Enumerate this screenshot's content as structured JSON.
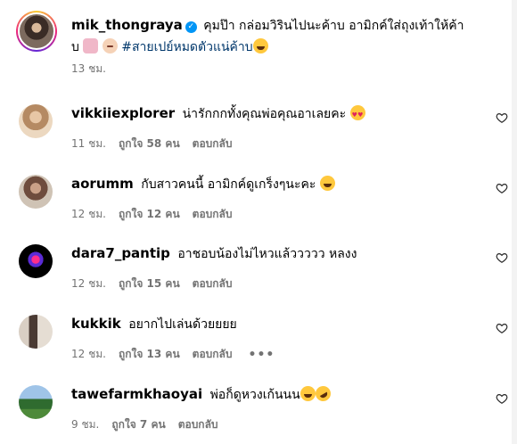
{
  "caption": {
    "username": "mik_thongraya",
    "text_line1": "คุมป๊า กล่อมวิรินไปนะค้าบ อามิกค์ใส่ถุงเท้าให้ค้า",
    "text_line2_prefix": "บ",
    "hashtag": "#สายเปย์หมดตัวแน่ค้าบ",
    "time": "13 ชม.",
    "emojis": [
      "ballet-shoes-emoji",
      "baby-emoji",
      "laughing-emoji"
    ]
  },
  "labels": {
    "reply": "ตอบกลับ",
    "more": "•••"
  },
  "comments": [
    {
      "username": "vikkiiexplorer",
      "text": "น่ารักกกทั้งคุณพ่อคุณอาเลยคะ",
      "emoji": "heart-eyes-emoji",
      "time": "11 ชม.",
      "likes": "ถูกใจ 58 คน"
    },
    {
      "username": "aorumm",
      "text": "กับสาวคนนี้ อามิกค์ดูเกร็งๆนะคะ",
      "emoji": "laughing-emoji",
      "time": "12 ชม.",
      "likes": "ถูกใจ 12 คน"
    },
    {
      "username": "dara7_pantip",
      "text": "อาชอบน้องไม่ไหวแล้ววววว หลงง",
      "time": "12 ชม.",
      "likes": "ถูกใจ 15 คน"
    },
    {
      "username": "kukkik",
      "text": "อยากไปเล่นด้วยยยย",
      "time": "12 ชม.",
      "likes": "ถูกใจ 13 คน"
    },
    {
      "username": "tawefarmkhaoyai",
      "text": "พ่อก็ดูหวงเก้นนน",
      "emoji": "laughing-emoji rofl-emoji",
      "time": "9 ชม.",
      "likes": "ถูกใจ 7 คน"
    }
  ],
  "colors": {
    "meta_gray": "#737373",
    "hashtag_blue": "#00376b",
    "verified_blue": "#0095f6"
  }
}
